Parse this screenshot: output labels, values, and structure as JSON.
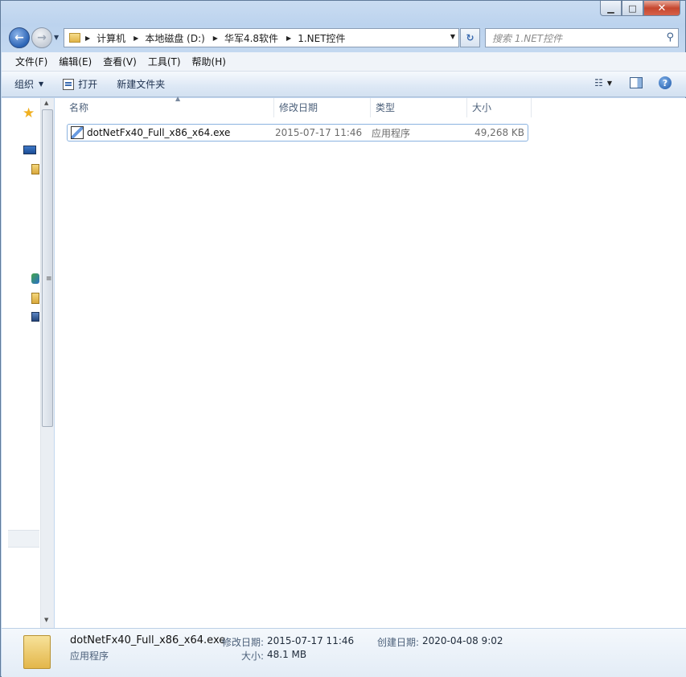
{
  "window": {
    "min_label": "▁",
    "max_label": "□",
    "close_label": "✕"
  },
  "address": {
    "crumbs": [
      "计算机",
      "本地磁盘 (D:)",
      "华军4.8软件",
      "1.NET控件"
    ]
  },
  "search": {
    "placeholder": "搜索 1.NET控件"
  },
  "menu": {
    "items": [
      "文件(F)",
      "编辑(E)",
      "查看(V)",
      "工具(T)",
      "帮助(H)"
    ]
  },
  "toolbar": {
    "organize": "组织",
    "open": "打开",
    "new_folder": "新建文件夹"
  },
  "columns": {
    "name": "名称",
    "modified": "修改日期",
    "type": "类型",
    "size": "大小"
  },
  "files": [
    {
      "name": "dotNetFx40_Full_x86_x64.exe",
      "modified": "2015-07-17 11:46",
      "type": "应用程序",
      "size": "49,268 KB"
    }
  ],
  "details": {
    "filename": "dotNetFx40_Full_x86_x64.exe",
    "filetype": "应用程序",
    "modified_label": "修改日期:",
    "modified_value": "2015-07-17 11:46",
    "created_label": "创建日期:",
    "created_value": "2020-04-08 9:02",
    "size_label": "大小:",
    "size_value": "48.1 MB"
  }
}
